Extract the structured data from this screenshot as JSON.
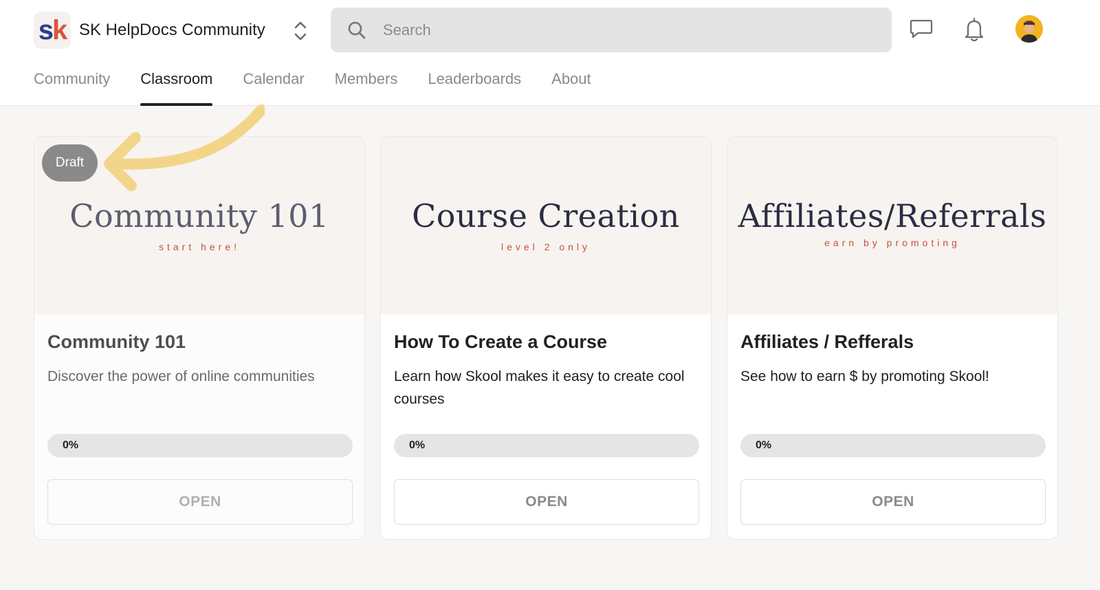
{
  "header": {
    "community_name": "SK HelpDocs Community",
    "logo_letters": {
      "first": "s",
      "second": "k"
    },
    "search": {
      "placeholder": "Search",
      "value": ""
    },
    "icons": [
      "search-icon",
      "chat-icon",
      "bell-icon",
      "avatar"
    ]
  },
  "nav": {
    "tabs": [
      {
        "label": "Community",
        "active": false
      },
      {
        "label": "Classroom",
        "active": true
      },
      {
        "label": "Calendar",
        "active": false
      },
      {
        "label": "Members",
        "active": false
      },
      {
        "label": "Leaderboards",
        "active": false
      },
      {
        "label": "About",
        "active": false
      }
    ]
  },
  "courses": [
    {
      "cover_title": "Community 101",
      "cover_subtitle": "start here!",
      "badge": "Draft",
      "title": "Community 101",
      "description": "Discover the power of online communities",
      "progress": 0,
      "progress_label": "0%",
      "button": "OPEN"
    },
    {
      "cover_title": "Course Creation",
      "cover_subtitle": "level 2 only",
      "title": "How To Create a Course",
      "description": "Learn how Skool makes it easy to create cool courses",
      "progress": 0,
      "progress_label": "0%",
      "button": "OPEN"
    },
    {
      "cover_title": "Affiliates/Referrals",
      "cover_subtitle": "earn by promoting",
      "title": "Affiliates / Refferals",
      "description": "See how to earn $ by promoting Skool!",
      "progress": 0,
      "progress_label": "0%",
      "button": "OPEN"
    }
  ],
  "colors": {
    "accent_arrow": "#f3d58a",
    "active_tab": "#202124",
    "badge_bg": "#8a8a8a",
    "cover_subtitle": "#c1533c",
    "page_bg": "#f7f6f4"
  }
}
